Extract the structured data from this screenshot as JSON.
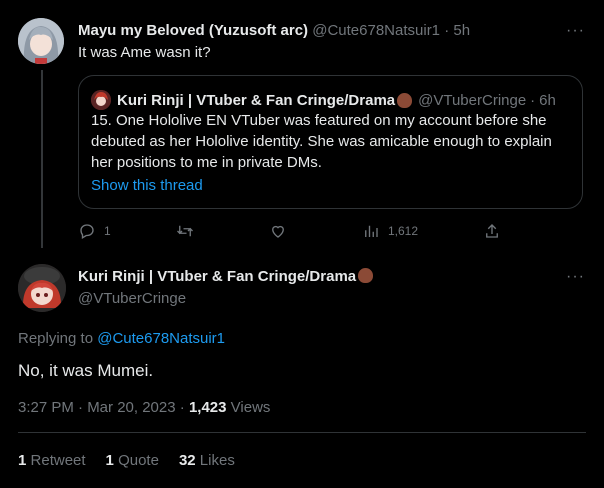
{
  "tweet1": {
    "name": "Mayu my Beloved (Yuzusoft arc)",
    "handle": "@Cute678Natsuir1",
    "time": "5h",
    "text": "It was Ame wasn it?"
  },
  "quote": {
    "name": "Kuri Rinji | VTuber & Fan Cringe/Drama",
    "handle": "@VTuberCringe",
    "time": "6h",
    "text": "15. One Hololive EN VTuber was featured on my account before she debuted as her Hololive identity. She was amicable enough to explain her positions to me in private DMs.",
    "link": "Show this thread"
  },
  "actions": {
    "replies": "1",
    "views": "1,612"
  },
  "tweet2": {
    "name": "Kuri Rinji | VTuber & Fan Cringe/Drama",
    "handle": "@VTuberCringe",
    "replying_prefix": "Replying to",
    "replying_to": "@Cute678Natsuir1",
    "text": "No, it was Mumei.",
    "datetime": "3:27 PM · Mar 20, 2023",
    "views_count": "1,423",
    "views_label": "Views"
  },
  "stats": {
    "retweets_count": "1",
    "retweets_label": "Retweet",
    "quotes_count": "1",
    "quotes_label": "Quote",
    "likes_count": "32",
    "likes_label": "Likes"
  },
  "colors": {
    "background": "#000000",
    "accent": "#1d9bf0",
    "muted": "#71767b",
    "border": "#2f3336"
  },
  "icons": {
    "reply": "reply-icon",
    "retweet": "retweet-icon",
    "like": "like-icon",
    "views": "views-icon",
    "share": "share-icon",
    "more": "more-icon",
    "acorn": "acorn-emoji-icon"
  }
}
